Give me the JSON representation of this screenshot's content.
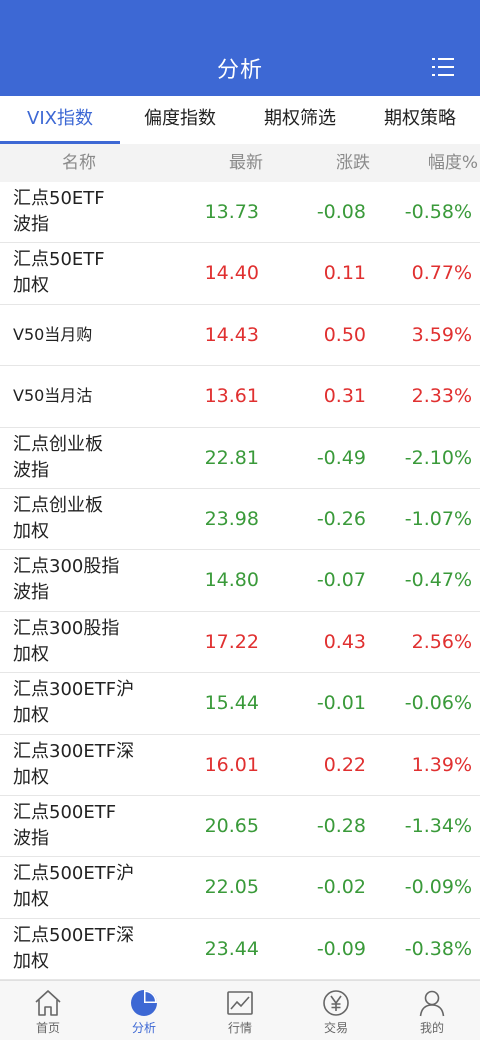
{
  "header": {
    "title": "分析"
  },
  "tabs": [
    {
      "label": "VIX指数",
      "active": true
    },
    {
      "label": "偏度指数",
      "active": false
    },
    {
      "label": "期权筛选",
      "active": false
    },
    {
      "label": "期权策略",
      "active": false
    }
  ],
  "columns": {
    "name": "名称",
    "latest": "最新",
    "change": "涨跌",
    "amplitude": "幅度%"
  },
  "rows": [
    {
      "name_line1": "汇点50ETF",
      "name_line2": "波指",
      "latest": "13.73",
      "change": "-0.08",
      "amplitude": "-0.58%",
      "trend": "down"
    },
    {
      "name_line1": "汇点50ETF",
      "name_line2": "加权",
      "latest": "14.40",
      "change": "0.11",
      "amplitude": "0.77%",
      "trend": "up"
    },
    {
      "name_line1": "V50当月购",
      "name_line2": "",
      "latest": "14.43",
      "change": "0.50",
      "amplitude": "3.59%",
      "trend": "up"
    },
    {
      "name_line1": "V50当月沽",
      "name_line2": "",
      "latest": "13.61",
      "change": "0.31",
      "amplitude": "2.33%",
      "trend": "up"
    },
    {
      "name_line1": "汇点创业板",
      "name_line2": "波指",
      "latest": "22.81",
      "change": "-0.49",
      "amplitude": "-2.10%",
      "trend": "down"
    },
    {
      "name_line1": "汇点创业板",
      "name_line2": "加权",
      "latest": "23.98",
      "change": "-0.26",
      "amplitude": "-1.07%",
      "trend": "down"
    },
    {
      "name_line1": "汇点300股指",
      "name_line2": "波指",
      "latest": "14.80",
      "change": "-0.07",
      "amplitude": "-0.47%",
      "trend": "down"
    },
    {
      "name_line1": "汇点300股指",
      "name_line2": "加权",
      "latest": "17.22",
      "change": "0.43",
      "amplitude": "2.56%",
      "trend": "up"
    },
    {
      "name_line1": "汇点300ETF沪",
      "name_line2": "加权",
      "latest": "15.44",
      "change": "-0.01",
      "amplitude": "-0.06%",
      "trend": "down"
    },
    {
      "name_line1": "汇点300ETF深",
      "name_line2": "加权",
      "latest": "16.01",
      "change": "0.22",
      "amplitude": "1.39%",
      "trend": "up"
    },
    {
      "name_line1": "汇点500ETF",
      "name_line2": "波指",
      "latest": "20.65",
      "change": "-0.28",
      "amplitude": "-1.34%",
      "trend": "down"
    },
    {
      "name_line1": "汇点500ETF沪",
      "name_line2": "加权",
      "latest": "22.05",
      "change": "-0.02",
      "amplitude": "-0.09%",
      "trend": "down"
    },
    {
      "name_line1": "汇点500ETF深",
      "name_line2": "加权",
      "latest": "23.44",
      "change": "-0.09",
      "amplitude": "-0.38%",
      "trend": "down"
    }
  ],
  "bottom_nav": [
    {
      "label": "首页",
      "icon": "home-icon",
      "active": false
    },
    {
      "label": "分析",
      "icon": "pie-chart-icon",
      "active": true
    },
    {
      "label": "行情",
      "icon": "line-chart-icon",
      "active": false
    },
    {
      "label": "交易",
      "icon": "yen-icon",
      "active": false
    },
    {
      "label": "我的",
      "icon": "user-icon",
      "active": false
    }
  ],
  "colors": {
    "accent": "#3d68d4",
    "up": "#e03030",
    "down": "#3a9a3a"
  }
}
